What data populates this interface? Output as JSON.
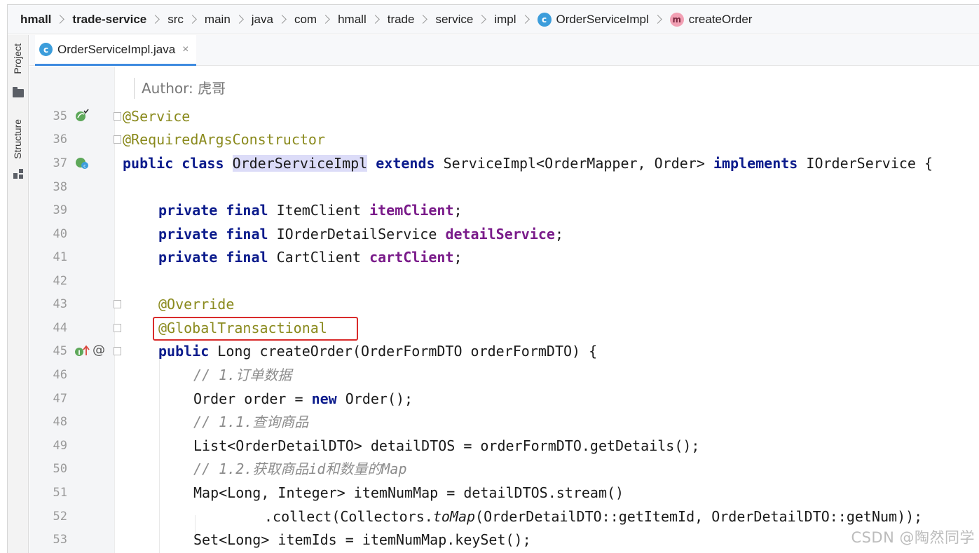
{
  "breadcrumb": {
    "items": [
      "hmall",
      "trade-service",
      "src",
      "main",
      "java",
      "com",
      "hmall",
      "trade",
      "service",
      "impl",
      "OrderServiceImpl",
      "createOrder"
    ],
    "class_badge": "c",
    "method_badge": "m"
  },
  "toolstrip": {
    "project_label": "Project",
    "structure_label": "Structure"
  },
  "tab": {
    "badge": "c",
    "filename": "OrderServiceImpl.java",
    "close": "×"
  },
  "editor": {
    "author": "Author: 虎哥",
    "lines": [
      {
        "n": "35"
      },
      {
        "n": "36"
      },
      {
        "n": "37"
      },
      {
        "n": "38"
      },
      {
        "n": "39"
      },
      {
        "n": "40"
      },
      {
        "n": "41"
      },
      {
        "n": "42"
      },
      {
        "n": "43"
      },
      {
        "n": "44"
      },
      {
        "n": "45"
      },
      {
        "n": "46"
      },
      {
        "n": "47"
      },
      {
        "n": "48"
      },
      {
        "n": "49"
      },
      {
        "n": "50"
      },
      {
        "n": "51"
      },
      {
        "n": "52"
      },
      {
        "n": "53"
      }
    ],
    "code": {
      "l35": "@Service",
      "l36": "@RequiredArgsConstructor",
      "l37_public": "public",
      "l37_class": "class",
      "l37_name": "OrderServiceImpl",
      "l37_extends": "extends",
      "l37_base": "ServiceImpl<OrderMapper, Order>",
      "l37_implements": "implements",
      "l37_iface": "IOrderService {",
      "private": "private",
      "final": "final",
      "l39_type": "ItemClient",
      "l39_field": "itemClient",
      "l40_type": "IOrderDetailService",
      "l40_field": "detailService",
      "l41_type": "CartClient",
      "l41_field": "cartClient",
      "semicolon": ";",
      "l43": "@Override",
      "l44": "@GlobalTransactional",
      "l45_public": "public",
      "l45_rest": "Long createOrder(OrderFormDTO orderFormDTO) {",
      "l46": "// 1.订单数据",
      "l47_a": "Order order = ",
      "l47_new": "new",
      "l47_b": " Order();",
      "l48": "// 1.1.查询商品",
      "l49": "List<OrderDetailDTO> detailDTOS = orderFormDTO.getDetails();",
      "l50": "// 1.2.获取商品id和数量的Map",
      "l51": "Map<Long, Integer> itemNumMap = detailDTOS.stream()",
      "l52_a": ".collect(Collectors.",
      "l52_ital": "toMap",
      "l52_b": "(OrderDetailDTO::getItemId, OrderDetailDTO::getNum));",
      "l53": "Set<Long> itemIds = itemNumMap.keySet();"
    },
    "gutter_at": "@"
  },
  "watermark": "CSDN @陶然同学",
  "colors": {
    "keyword": "#0b1b8c",
    "annotation": "#8a8a1d",
    "field": "#7a1b8a",
    "comment": "#8c8c8c",
    "highlight_box": "#d92b2b",
    "tab_underline": "#3f8be0"
  }
}
